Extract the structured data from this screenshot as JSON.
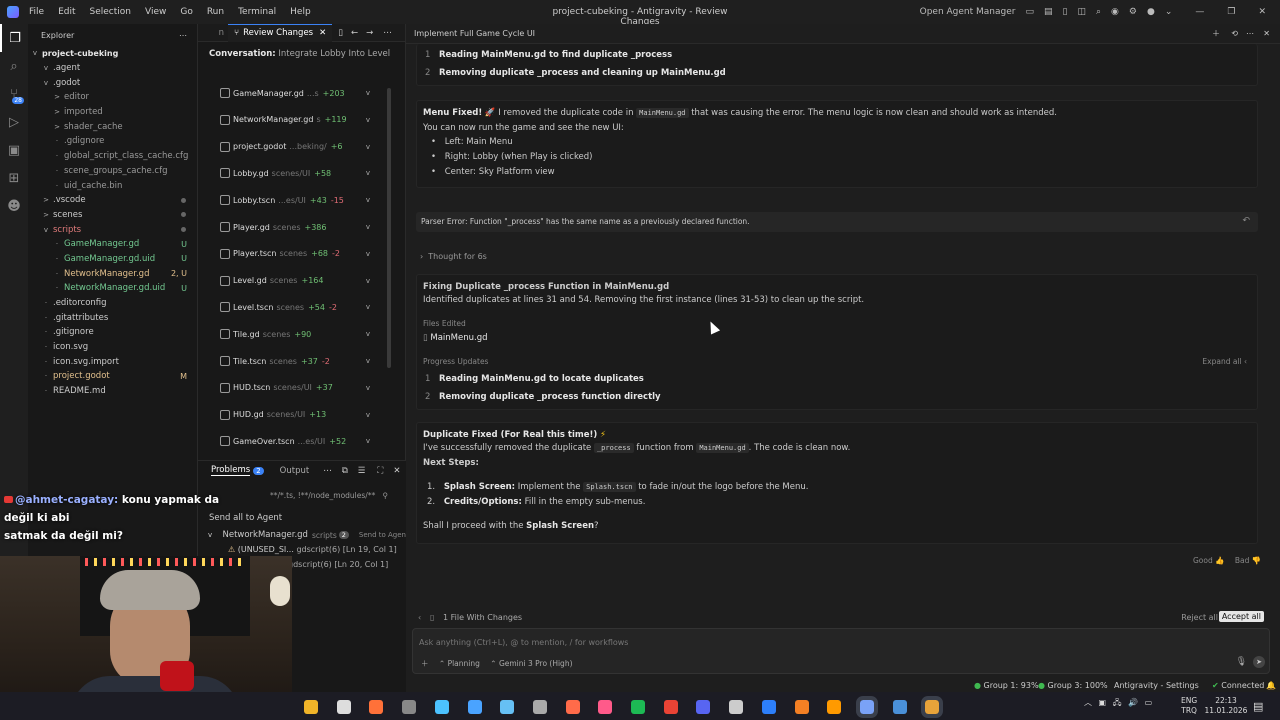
{
  "window": {
    "title": "project-cubeking - Antigravity - Review Changes",
    "menu": [
      "File",
      "Edit",
      "Selection",
      "View",
      "Go",
      "Run",
      "Terminal",
      "Help"
    ],
    "open_agent": "Open Agent Manager"
  },
  "explorer": {
    "header": "Explorer",
    "project": "project-cubeking",
    "items": [
      {
        "name": ".agent",
        "indent": 1,
        "chev": "v",
        "color": "#ccc"
      },
      {
        "name": ".godot",
        "indent": 1,
        "chev": "v",
        "color": "#ccc"
      },
      {
        "name": "editor",
        "indent": 2,
        "chev": ">",
        "color": "#9a9a9a"
      },
      {
        "name": "imported",
        "indent": 2,
        "chev": ">",
        "color": "#9a9a9a"
      },
      {
        "name": "shader_cache",
        "indent": 2,
        "chev": ">",
        "color": "#9a9a9a"
      },
      {
        "name": ".gdignore",
        "indent": 2,
        "chev": "",
        "color": "#9a9a9a"
      },
      {
        "name": "global_script_class_cache.cfg",
        "indent": 2,
        "chev": "",
        "color": "#9a9a9a"
      },
      {
        "name": "scene_groups_cache.cfg",
        "indent": 2,
        "chev": "",
        "color": "#9a9a9a"
      },
      {
        "name": "uid_cache.bin",
        "indent": 2,
        "chev": "",
        "color": "#9a9a9a"
      },
      {
        "name": ".vscode",
        "indent": 1,
        "chev": ">",
        "color": "#ccc",
        "dot": true
      },
      {
        "name": "scenes",
        "indent": 1,
        "chev": ">",
        "color": "#ccc",
        "dot": true
      },
      {
        "name": "scripts",
        "indent": 1,
        "chev": "v",
        "color": "#e07b7b",
        "dot": true
      },
      {
        "name": "GameManager.gd",
        "indent": 2,
        "chev": "",
        "color": "#73c991",
        "badge": "U"
      },
      {
        "name": "GameManager.gd.uid",
        "indent": 2,
        "chev": "",
        "color": "#73c991",
        "badge": "U"
      },
      {
        "name": "NetworkManager.gd",
        "indent": 2,
        "chev": "",
        "color": "#e2c08d",
        "badge": "2, U"
      },
      {
        "name": "NetworkManager.gd.uid",
        "indent": 2,
        "chev": "",
        "color": "#73c991",
        "badge": "U"
      },
      {
        "name": ".editorconfig",
        "indent": 1,
        "chev": "",
        "color": "#ccc"
      },
      {
        "name": ".gitattributes",
        "indent": 1,
        "chev": "",
        "color": "#ccc"
      },
      {
        "name": ".gitignore",
        "indent": 1,
        "chev": "",
        "color": "#ccc"
      },
      {
        "name": "icon.svg",
        "indent": 1,
        "chev": "",
        "color": "#ccc"
      },
      {
        "name": "icon.svg.import",
        "indent": 1,
        "chev": "",
        "color": "#ccc"
      },
      {
        "name": "project.godot",
        "indent": 1,
        "chev": "",
        "color": "#e2c08d",
        "badge": "M"
      },
      {
        "name": "README.md",
        "indent": 1,
        "chev": "",
        "color": "#ccc"
      }
    ]
  },
  "review": {
    "tab": "Review Changes",
    "conversation_label": "Conversation:",
    "conversation": "Integrate Lobby Into Level",
    "files": [
      {
        "name": "GameManager.gd",
        "path": "...s",
        "add": "+203",
        "del": ""
      },
      {
        "name": "NetworkManager.gd",
        "path": "s",
        "add": "+119",
        "del": ""
      },
      {
        "name": "project.godot",
        "path": "...beking/",
        "add": "+6",
        "del": ""
      },
      {
        "name": "Lobby.gd",
        "path": "scenes/UI",
        "add": "+58",
        "del": ""
      },
      {
        "name": "Lobby.tscn",
        "path": "...es/UI",
        "add": "+43",
        "del": "-15"
      },
      {
        "name": "Player.gd",
        "path": "scenes",
        "add": "+386",
        "del": ""
      },
      {
        "name": "Player.tscn",
        "path": "scenes",
        "add": "+68",
        "del": "-2"
      },
      {
        "name": "Level.gd",
        "path": "scenes",
        "add": "+164",
        "del": ""
      },
      {
        "name": "Level.tscn",
        "path": "scenes",
        "add": "+54",
        "del": "-2"
      },
      {
        "name": "Tile.gd",
        "path": "scenes",
        "add": "+90",
        "del": ""
      },
      {
        "name": "Tile.tscn",
        "path": "scenes",
        "add": "+37",
        "del": "-2"
      },
      {
        "name": "HUD.tscn",
        "path": "scenes/UI",
        "add": "+37",
        "del": ""
      },
      {
        "name": "HUD.gd",
        "path": "scenes/UI",
        "add": "+13",
        "del": ""
      },
      {
        "name": "GameOver.tscn",
        "path": "...es/UI",
        "add": "+52",
        "del": ""
      }
    ]
  },
  "problems": {
    "tab": "Problems",
    "count": "2",
    "output": "Output",
    "filter": "**/*.ts, !**/node_modules/**",
    "send_all": "Send all to Agent",
    "file": "NetworkManager.gd",
    "folder": "scripts",
    "file_count": "2",
    "send": "Send to Agen",
    "rows": [
      {
        "text": "(UNUSED_SI...",
        "src": "gdscript(6)",
        "loc": "[Ln 19, Col 1]"
      },
      {
        "text": "",
        "src": "gdscript(6)",
        "loc": "[Ln 20, Col 1]"
      }
    ]
  },
  "chat_overlay": {
    "user": "@ahmet-cagatay:",
    "line1": "konu yapmak da değil ki abi",
    "line2": "satmak da değil mi?"
  },
  "chat": {
    "title": "Implement Full Game Cycle UI",
    "top_steps": [
      "Reading MainMenu.gd to find duplicate _process",
      "Removing duplicate _process and cleaning up MainMenu.gd"
    ],
    "menu_fixed": {
      "title": "Menu Fixed!",
      "emoji": "🚀",
      "text1": "I removed the duplicate code in",
      "code": "MainMenu.gd",
      "text2": "that was causing the error. The menu logic is now clean and should work as intended.",
      "line2": "You can now run the game and see the new UI:",
      "bullets": [
        "Left: Main Menu",
        "Right: Lobby (when Play is clicked)",
        "Center: Sky Platform view"
      ]
    },
    "parser_error": "Parser Error: Function \"_process\" has the same name as a previously declared function.",
    "thought": "Thought for 6s",
    "fixing": {
      "title": "Fixing Duplicate _process Function in MainMenu.gd",
      "desc": "Identified duplicates at lines 31 and 54. Removing the first instance (lines 31-53) to clean up the script.",
      "files_edited": "Files Edited",
      "file": "MainMenu.gd",
      "progress": "Progress Updates",
      "expand": "Expand all",
      "steps": [
        "Reading MainMenu.gd to locate duplicates",
        "Removing duplicate _process function directly"
      ]
    },
    "dup_fixed": {
      "title": "Duplicate Fixed (For Real this time!)",
      "emoji": "⚡",
      "p1": "I've successfully removed the duplicate",
      "code1": "_process",
      "p2": "function from",
      "code2": "MainMenu.gd",
      "p3": ". The code is clean now.",
      "next": "Next Steps:",
      "steps": [
        {
          "b": "Splash Screen:",
          "t1": "Implement the",
          "code": "Splash.tscn",
          "t2": "to fade in/out the logo before the Menu."
        },
        {
          "b": "Credits/Options:",
          "t1": "Fill in the empty sub-menus.",
          "code": "",
          "t2": ""
        }
      ],
      "ask1": "Shall I proceed with the",
      "askb": "Splash Screen",
      "ask2": "?"
    },
    "good": "Good",
    "bad": "Bad",
    "changes": "1 File With Changes",
    "reject": "Reject all",
    "accept": "Accept all",
    "placeholder": "Ask anything (Ctrl+L), @ to mention, / for workflows",
    "mode": "Planning",
    "model": "Gemini 3 Pro (High)"
  },
  "statusbar": {
    "g1": "Group 1: 93%",
    "g3": "Group 3: 100%",
    "settings": "Antigravity - Settings",
    "connected": "Connected"
  },
  "taskbar": {
    "lang": "ENG",
    "region": "TRQ",
    "time": "22:13",
    "date": "11.01.2026"
  }
}
